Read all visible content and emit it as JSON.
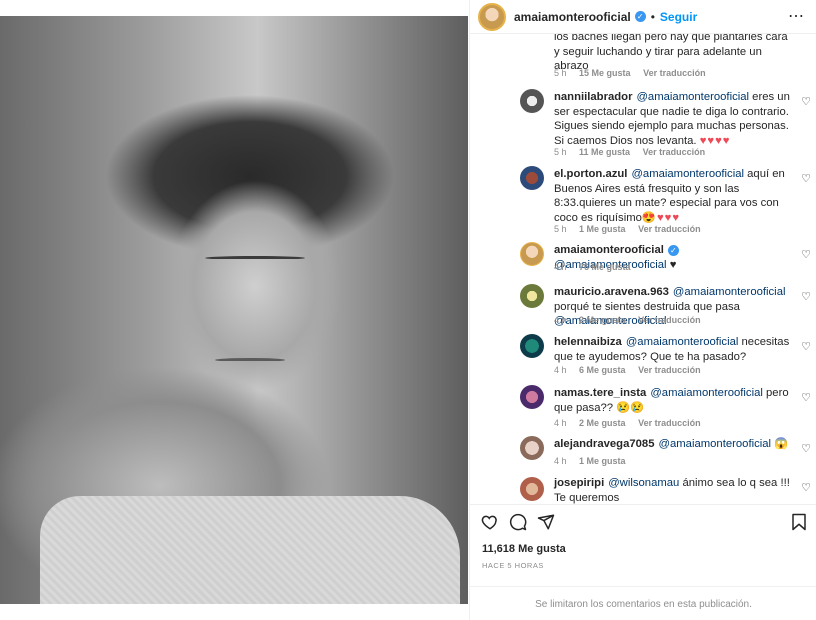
{
  "post": {
    "username": "amaiamonterooficial",
    "follow_label": "Seguir",
    "separator": "•",
    "more_label": "⋯"
  },
  "comments": [
    {
      "id": "c0",
      "username": "",
      "mention": "",
      "text": "los baches llegan pero hay que plantarles cara y seguir luchando y tirar para adelante un abrazo",
      "emoji": "",
      "time": "5 h",
      "likes": "15 Me gusta",
      "reply": "Ver traducción"
    },
    {
      "id": "c1",
      "username": "nanniilabrador",
      "mention": "@amaiamonterooficial",
      "text": " eres un ser espectacular que nadie te diga lo contrario. Sigues siendo ejemplo para muchas personas. Si caemos Dios nos levanta. ",
      "emoji": "♥♥♥♥",
      "time": "5 h",
      "likes": "11 Me gusta",
      "reply": "Ver traducción"
    },
    {
      "id": "c2",
      "username": "el.porton.azul",
      "mention": "@amaiamonterooficial",
      "text": " aquí en Buenos Aires está fresquito y son las 8:33.quieres un mate? especial para vos con coco es riquísimo",
      "emoji": "😍♥♥♥",
      "time": "5 h",
      "likes": "1 Me gusta",
      "reply": "Ver traducción"
    },
    {
      "id": "c3",
      "username": "amaiamonterooficial",
      "mention": "@amaiamonterooficial",
      "text": " ",
      "emoji": "♥",
      "time": "4 h",
      "likes": "76 Me gusta",
      "reply": ""
    },
    {
      "id": "c4",
      "username": "mauricio.aravena.963",
      "mention": "@amaiamonterooficial",
      "text": " porqué te sientes destruida que pasa ",
      "mention2": "@amaiamonterooficial",
      "emoji": "",
      "time": "4 h",
      "likes": "2 Me gusta",
      "reply": "Ver traducción"
    },
    {
      "id": "c5",
      "username": "helennaibiza",
      "mention": "@amaiamonterooficial",
      "text": " necesitas que te ayudemos? Que te ha pasado?",
      "emoji": "",
      "time": "4 h",
      "likes": "6 Me gusta",
      "reply": "Ver traducción"
    },
    {
      "id": "c6",
      "username": "namas.tere_insta",
      "mention": "@amaiamonterooficial",
      "text": " pero que pasa?? ",
      "emoji": "😢😢",
      "time": "4 h",
      "likes": "2 Me gusta",
      "reply": "Ver traducción"
    },
    {
      "id": "c7",
      "username": "alejandravega7085",
      "mention": "@amaiamonterooficial",
      "text": " ",
      "emoji": "😱",
      "time": "4 h",
      "likes": "1 Me gusta",
      "reply": ""
    },
    {
      "id": "c8",
      "username": "josepiripi",
      "mention": "@wilsonamau",
      "text": " ánimo sea lo q sea !!! Te queremos",
      "emoji": "",
      "time": "",
      "likes": "",
      "reply": ""
    }
  ],
  "actions": {
    "like_icon": "heart-outline",
    "comment_icon": "speech-bubble",
    "share_icon": "paper-plane",
    "save_icon": "bookmark"
  },
  "likes_count": "11,618 Me gusta",
  "time_ago": "HACE 5 HORAS",
  "footer_text": "Se limitaron los comentarios en esta publicación.",
  "colors": {
    "accent": "#0095f6",
    "verified": "#3897f0",
    "heart": "#ed4956",
    "muted": "#8e8e8e"
  }
}
